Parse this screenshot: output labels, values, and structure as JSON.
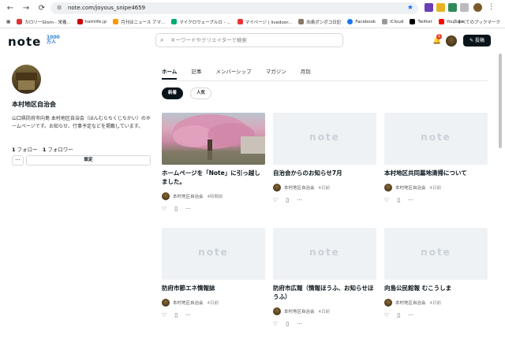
{
  "browser": {
    "url": "note.com/joyous_snipe4659",
    "bookmarks": [
      "カロリーSlism - 栄養...",
      "hamlife.jp",
      "月刊ほニュース アマ...",
      "マイクロウェーブルロ - ...",
      "マイページ | livedoor...",
      "向島ポンポコ日記",
      "Facebook",
      "iCloud",
      "Twitter",
      "YouTube"
    ],
    "all_bookmarks": "すべてのブックマーク"
  },
  "header": {
    "logo": "note",
    "badge_top": "1000",
    "badge_bottom": "万人",
    "search_placeholder": "キーワードやクリエイターで検索",
    "notification_count": "1",
    "post_label": "投稿"
  },
  "profile": {
    "name": "本村地区自治会",
    "description": "山口県防府市向島 本村地区自治会（ほんむらちくじちかい）のホームページです。お知らせ、行事予定などを掲載しています。",
    "following_count": "1",
    "following_label": "フォロー",
    "followers_count": "1",
    "followers_label": "フォロワー",
    "more_label": "···",
    "settings_label": "設定"
  },
  "tabs": [
    "ホーム",
    "記事",
    "メンバーシップ",
    "マガジン",
    "月別"
  ],
  "filters": {
    "new": "新着",
    "popular": "人気"
  },
  "cards": [
    {
      "title": "ホームページを「Note」に引っ越しました。",
      "author": "本村地区自治会",
      "time": "4時間前",
      "has_photo": true
    },
    {
      "title": "自治会からのお知らせ7月",
      "author": "本村地区自治会",
      "time": "4日前",
      "has_photo": false
    },
    {
      "title": "本村地区共同墓地清掃について",
      "author": "本村地区自治会",
      "time": "4日前",
      "has_photo": false
    },
    {
      "title": "防府市節エネ情報誌",
      "author": "本村地区自治会",
      "time": "4日前",
      "has_photo": false
    },
    {
      "title": "防府市広報（情報ほうふ、お知らせほうふ）",
      "author": "本村地区自治会",
      "time": "4日前",
      "has_photo": false
    },
    {
      "title": "向島公民館報 むこうしま",
      "author": "本村地区自治会",
      "time": "4日前",
      "has_photo": false
    }
  ],
  "placeholder_logo": "note"
}
